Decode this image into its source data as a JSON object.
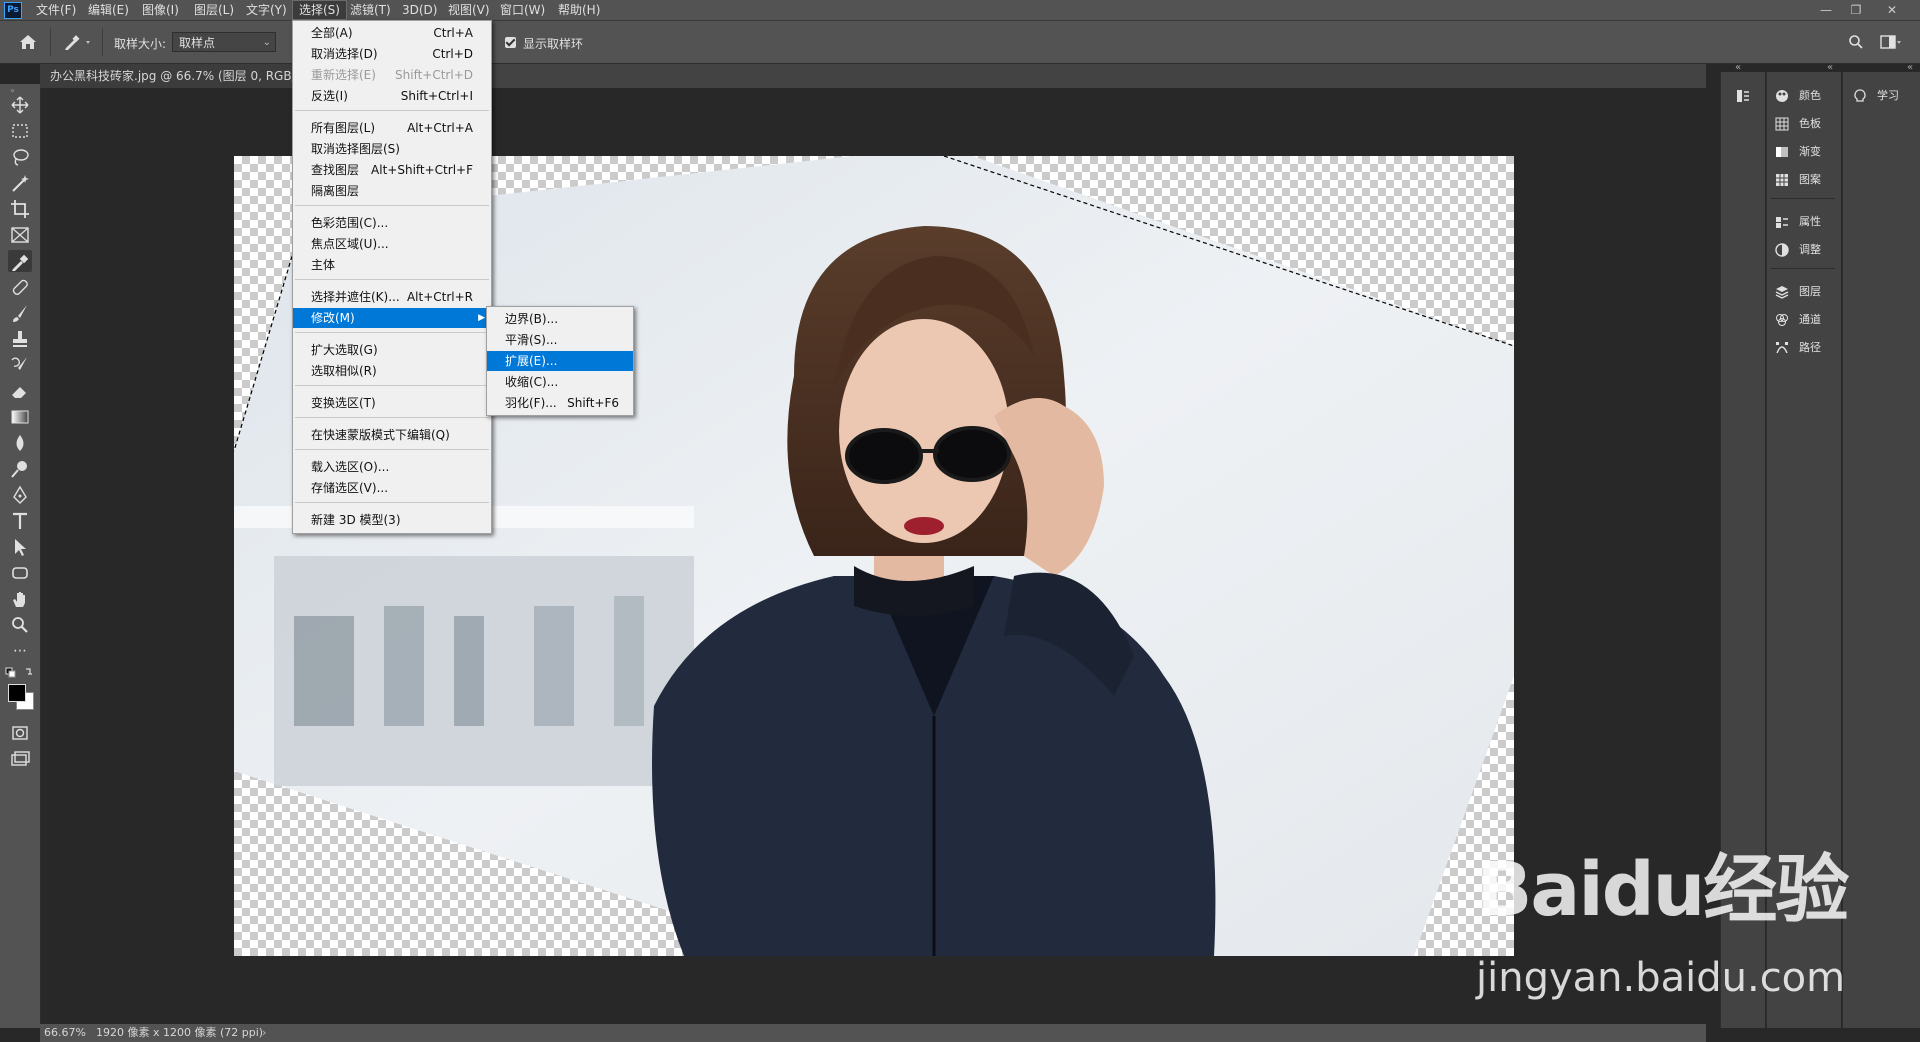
{
  "menubar": {
    "logo": "Ps",
    "items": [
      "文件(F)",
      "编辑(E)",
      "图像(I)",
      "图层(L)",
      "文字(Y)",
      "选择(S)",
      "滤镜(T)",
      "3D(D)",
      "视图(V)",
      "窗口(W)",
      "帮助(H)"
    ],
    "active_index": 5
  },
  "options": {
    "sample_size_label": "取样大小:",
    "sample_size_value": "取样点",
    "show_ring_label": "显示取样环",
    "show_ring_checked": true
  },
  "document": {
    "tab_title": "办公黑科技砖家.jpg @ 66.7% (图层 0, RGB/8",
    "zoom": "66.67%",
    "size_info": "1920 像素 x 1200 像素 (72 ppi)"
  },
  "select_menu": {
    "items": [
      {
        "label": "全部(A)",
        "shortcut": "Ctrl+A"
      },
      {
        "label": "取消选择(D)",
        "shortcut": "Ctrl+D"
      },
      {
        "label": "重新选择(E)",
        "shortcut": "Shift+Ctrl+D",
        "disabled": true
      },
      {
        "label": "反选(I)",
        "shortcut": "Shift+Ctrl+I"
      },
      {
        "label": "所有图层(L)",
        "shortcut": "Alt+Ctrl+A"
      },
      {
        "label": "取消选择图层(S)",
        "shortcut": ""
      },
      {
        "label": "查找图层",
        "shortcut": "Alt+Shift+Ctrl+F"
      },
      {
        "label": "隔离图层",
        "shortcut": ""
      },
      {
        "label": "色彩范围(C)...",
        "shortcut": ""
      },
      {
        "label": "焦点区域(U)...",
        "shortcut": ""
      },
      {
        "label": "主体",
        "shortcut": ""
      },
      {
        "label": "选择并遮住(K)...",
        "shortcut": "Alt+Ctrl+R"
      },
      {
        "label": "修改(M)",
        "shortcut": "",
        "highlighted": true,
        "submenu": true
      },
      {
        "label": "扩大选取(G)",
        "shortcut": ""
      },
      {
        "label": "选取相似(R)",
        "shortcut": ""
      },
      {
        "label": "变换选区(T)",
        "shortcut": ""
      },
      {
        "label": "在快速蒙版模式下编辑(Q)",
        "shortcut": ""
      },
      {
        "label": "载入选区(O)...",
        "shortcut": ""
      },
      {
        "label": "存储选区(V)...",
        "shortcut": ""
      },
      {
        "label": "新建 3D 模型(3)",
        "shortcut": ""
      }
    ]
  },
  "modify_submenu": {
    "items": [
      {
        "label": "边界(B)...",
        "shortcut": ""
      },
      {
        "label": "平滑(S)...",
        "shortcut": ""
      },
      {
        "label": "扩展(E)...",
        "shortcut": "",
        "highlighted": true
      },
      {
        "label": "收缩(C)...",
        "shortcut": ""
      },
      {
        "label": "羽化(F)...",
        "shortcut": "Shift+F6"
      }
    ]
  },
  "right_panels": {
    "group1": [
      "颜色",
      "色板",
      "渐变",
      "图案"
    ],
    "group2": [
      "属性",
      "调整"
    ],
    "group3": [
      "图层",
      "通道",
      "路径"
    ],
    "learn": "学习"
  },
  "watermark": {
    "logo": "Baidu经验",
    "url": "jingyan.baidu.com"
  },
  "colors": {
    "menu_highlight": "#0078d7",
    "ui_dark": "#535353",
    "workspace": "#282828"
  }
}
